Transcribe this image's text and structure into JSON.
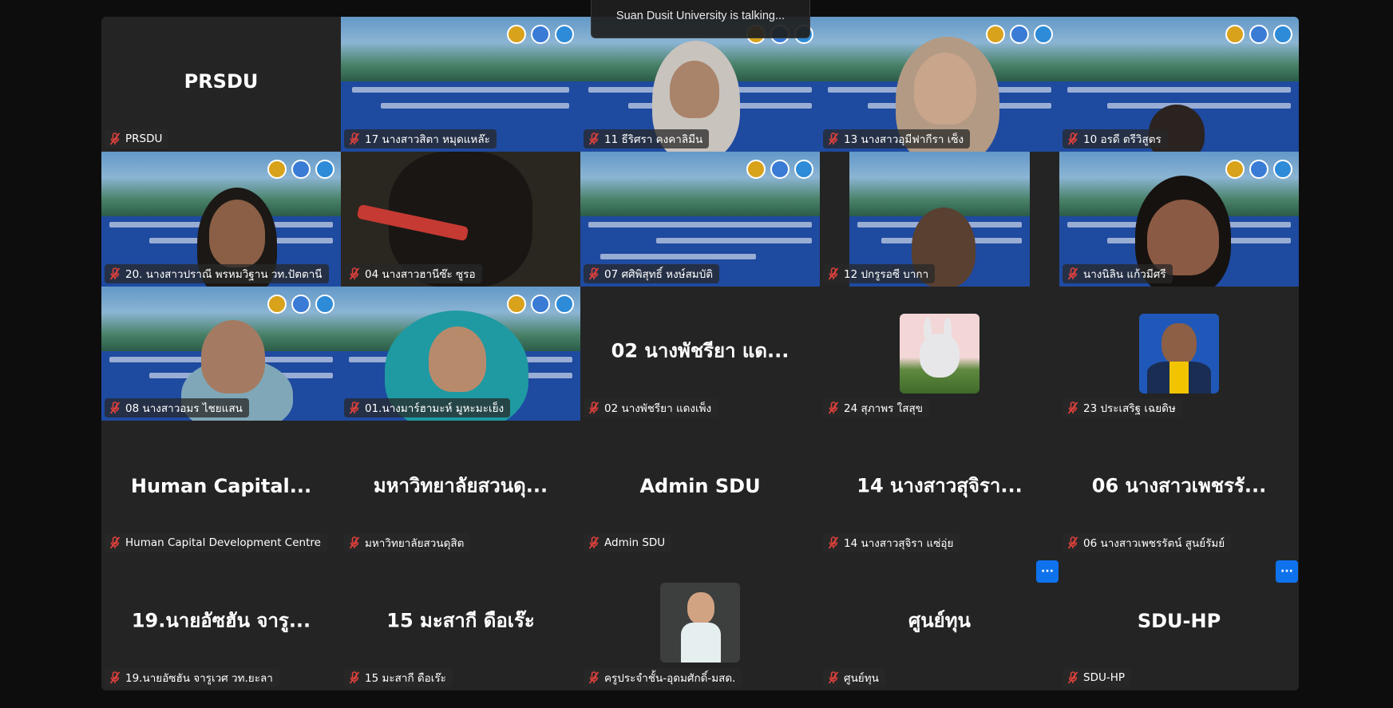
{
  "talking_banner": "Suan Dusit University is talking...",
  "colors": {
    "accent": "#0e72ed",
    "mute": "#e0413c",
    "tile_bg": "#242424",
    "banner_blue": "#1e4aa0"
  },
  "tiles": [
    {
      "big": "PRSDU",
      "label": "PRSDU"
    },
    {
      "label": "17 นางสาวสิตา หมุดแหล๊ะ"
    },
    {
      "label": "11 ธีริศรา คงคาลิมีน"
    },
    {
      "label": "13 นางสาวอุมีฟากีรา เซ็ง"
    },
    {
      "label": "10 อรดี ตรีวิสูตร"
    },
    {
      "label": "20. นางสาวปราณี  พรหมวิฐาน วท.ปัตตานี"
    },
    {
      "label": "04 นางสาวฮานีซ๊ะ  ซูรอ"
    },
    {
      "label": "07 ศศิพิสุทธิ์ หงษ์สมบัติ"
    },
    {
      "label": "12 ปกรูรอซี  บากา"
    },
    {
      "label": "นางนิลิน แก้วมีศรี"
    },
    {
      "label": "08 นางสาวอมร ไชยแสน"
    },
    {
      "label": "01.นางมาร์ฮามะห์  มูหะมะเย็ง"
    },
    {
      "big": "02 นางพัชรียา แด...",
      "label": "02 นางพัชรียา แดงเพ็ง"
    },
    {
      "label": "24 สุภาพร ใสสุข"
    },
    {
      "label": "23 ประเสริฐ เฉยดิษ"
    },
    {
      "big": "Human  Capital...",
      "label": "Human Capital Development Centre"
    },
    {
      "big": "มหาวิทยาลัยสวนดุ...",
      "label": "มหาวิทยาลัยสวนดุสิต"
    },
    {
      "big": "Admin SDU",
      "label": "Admin SDU"
    },
    {
      "big": "14 นางสาวสุจิรา...",
      "label": "14 นางสาวสุจิรา แซ่อุ่ย"
    },
    {
      "big": "06 นางสาวเพชรรั...",
      "label": "06 นางสาวเพชรรัตน์ สูนย์รัมย์"
    },
    {
      "big": "19.นายอัซฮัน จารู...",
      "label": "19.นายอัซฮัน จารูเวศ วท.ยะลา"
    },
    {
      "big": "15 มะสากี ดือเร๊ะ",
      "label": "15 มะสากี ดือเร๊ะ"
    },
    {
      "label": "ครูประจำชั้น-อุดมศักดิ์-มสด."
    },
    {
      "big": "ศูนย์ทุน",
      "label": "ศูนย์ทุน"
    },
    {
      "big": "SDU-HP",
      "label": "SDU-HP"
    }
  ],
  "more_button": "···"
}
